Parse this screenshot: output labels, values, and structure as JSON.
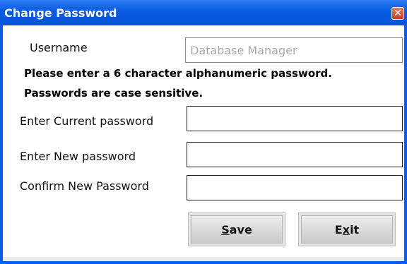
{
  "window": {
    "title": "Change Password",
    "close_glyph": "✕"
  },
  "username": {
    "label": "Username",
    "value": "Database Manager"
  },
  "instructions": {
    "line1": "Please enter a 6 character alphanumeric password.",
    "line2": "Passwords are case sensitive."
  },
  "fields": {
    "current": {
      "label": "Enter Current password",
      "value": ""
    },
    "new": {
      "label": "Enter New password",
      "value": ""
    },
    "confirm": {
      "label": "Confirm New Password",
      "value": ""
    }
  },
  "buttons": {
    "save": {
      "mnemonic": "S",
      "rest": "ave"
    },
    "exit": {
      "pre": "E",
      "mnemonic": "x",
      "post": "it"
    }
  },
  "colors": {
    "titlebar": "#0a5ce4",
    "close": "#d9502a"
  },
  "icons": {
    "close": "close-icon"
  }
}
